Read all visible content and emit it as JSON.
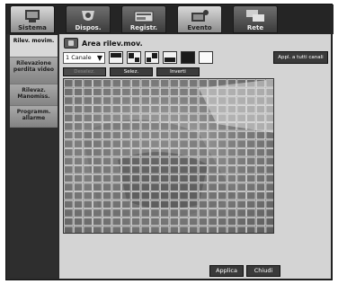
{
  "tabs": [
    {
      "label": "Sistema",
      "icon": "monitor-icon",
      "active": true
    },
    {
      "label": "Dispos.",
      "icon": "camera-icon",
      "active": false
    },
    {
      "label": "Registr.",
      "icon": "recorder-icon",
      "active": false
    },
    {
      "label": "Evento",
      "icon": "event-icon",
      "active": true
    },
    {
      "label": "Rete",
      "icon": "network-icon",
      "active": false
    }
  ],
  "sidebar": {
    "items": [
      {
        "label": "Rilev. movim.",
        "active": true
      },
      {
        "label": "Rilevazione perdita video",
        "active": false
      },
      {
        "label": "Rilevaz. Manomiss.",
        "active": false
      },
      {
        "label": "Programm. allarme",
        "active": false
      }
    ]
  },
  "main": {
    "title": "Area rilev.mov.",
    "channel_select": "1 Canale",
    "apply_all": "Appl. a tutti canali",
    "toolbar": {
      "deselect": "Deselez.",
      "select": "Selez.",
      "invert": "Inverti"
    },
    "apply": "Applica",
    "close": "Chiudi"
  },
  "colors": {
    "frame": "#2b2b2b",
    "panel": "#d4d4d4",
    "tab_active": "#d9d9d9",
    "button": "#3a3a3a"
  }
}
